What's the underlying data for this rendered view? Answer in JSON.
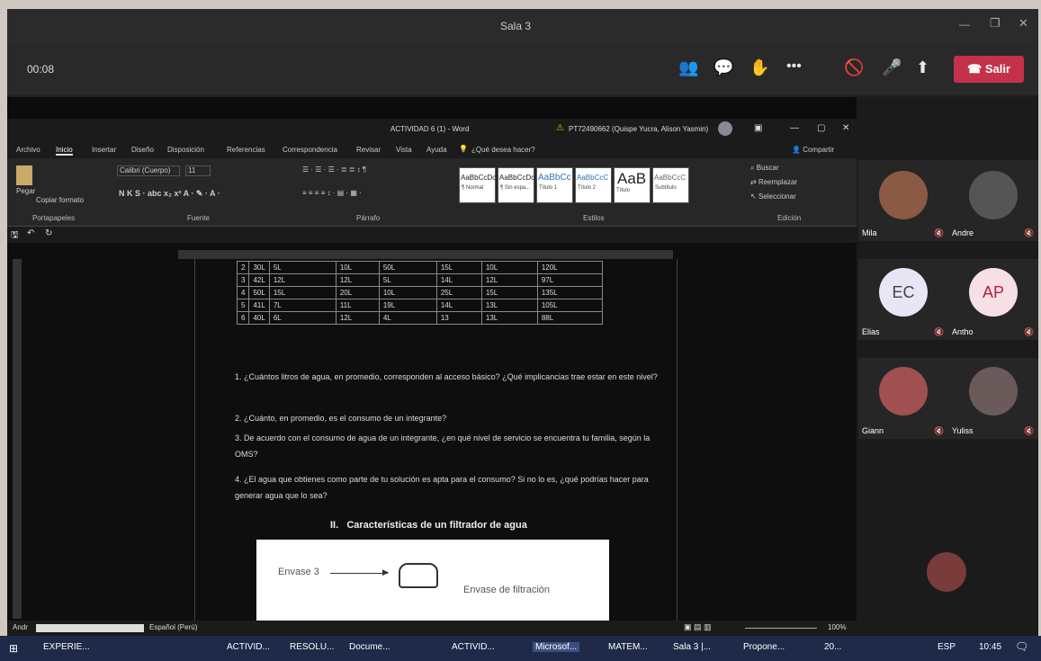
{
  "window": {
    "title": "Sala 3",
    "timer": "00:08",
    "leave_label": "Salir"
  },
  "word": {
    "doc_title": "ACTIVIDAD 6 (1) - Word",
    "user": "PT72490662 (Quispe Yucra, Alison Yasmin)",
    "tabs": [
      "Archivo",
      "Inicio",
      "Insertar",
      "Diseño",
      "Disposición",
      "Referencias",
      "Correspondencia",
      "Revisar",
      "Vista",
      "Ayuda"
    ],
    "search_placeholder": "¿Qué desea hacer?",
    "share_label": "Compartir",
    "ribbon": {
      "paste": "Pegar",
      "copy_format": "Copiar formato",
      "font": "Calibri (Cuerpo)",
      "size": "11",
      "groups": [
        "Portapapeles",
        "Fuente",
        "Párrafo",
        "Estilos",
        "Edición"
      ],
      "styles": [
        {
          "preview": "AaBbCcDc",
          "name": "¶ Normal"
        },
        {
          "preview": "AaBbCcDc",
          "name": "¶ Sin espa..."
        },
        {
          "preview": "AaBbCc",
          "name": "Título 1"
        },
        {
          "preview": "AaBbCcC",
          "name": "Título 2"
        },
        {
          "preview": "AaB",
          "name": "Título"
        },
        {
          "preview": "AaBbCcC",
          "name": "Subtítulo"
        }
      ],
      "editing": [
        "Buscar",
        "Reemplazar",
        "Seleccionar"
      ]
    },
    "table_rows": [
      [
        "2",
        "30L",
        "5L",
        "10L",
        "50L",
        "15L",
        "10L",
        "120L"
      ],
      [
        "3",
        "42L",
        "12L",
        "12L",
        "5L",
        "14L",
        "12L",
        "97L"
      ],
      [
        "4",
        "50L",
        "15L",
        "20L",
        "10L",
        "25L",
        "15L",
        "135L"
      ],
      [
        "5",
        "41L",
        "7L",
        "11L",
        "19L",
        "14L",
        "13L",
        "105L"
      ],
      [
        "6",
        "40L",
        "6L",
        "12L",
        "4L",
        "13",
        "13L",
        "88L"
      ]
    ],
    "questions": [
      "1.  ¿Cuántos litros de agua, en promedio, corresponden al acceso básico? ¿Qué implicancias trae estar en este nivel?",
      "2.  ¿Cuánto, en promedio, es el consumo de un integrante?",
      "3.  De acuerdo con el consumo de agua de un integrante, ¿en qué nivel de servicio se encuentra tu familia, según la OMS?",
      "4.  ¿El agua que obtienes como parte de tu solución es apta para el consumo? Si no lo es, ¿qué podrías hacer para generar agua que lo sea?"
    ],
    "section_title": "II.   Características de un filtrador de agua",
    "figure": {
      "label1": "Envase 3",
      "label2": "Envase de filtración"
    },
    "status_left": "Andr",
    "status_lang": "Español (Perú)",
    "zoom": "100%"
  },
  "participants": [
    {
      "name": "Mila",
      "initials": "",
      "color": "#8a5a44"
    },
    {
      "name": "Andre",
      "initials": "",
      "color": "#555555"
    },
    {
      "name": "Elias",
      "initials": "EC",
      "color": "#e8e6f5"
    },
    {
      "name": "Antho",
      "initials": "AP",
      "color": "#f7dfe6"
    },
    {
      "name": "Giann",
      "initials": "",
      "color": "#a05050"
    },
    {
      "name": "Yuliss",
      "initials": "",
      "color": "#6a5a5a"
    }
  ],
  "taskbar": {
    "items": [
      "EXPERIE...",
      "ACTIVID...",
      "RESOLU...",
      "Docume...",
      "ACTIVID...",
      "Microsof...",
      "MATEM...",
      "Sala 3 |...",
      "Propone...",
      "20..."
    ],
    "lang": "ESP",
    "time": "10:45"
  }
}
